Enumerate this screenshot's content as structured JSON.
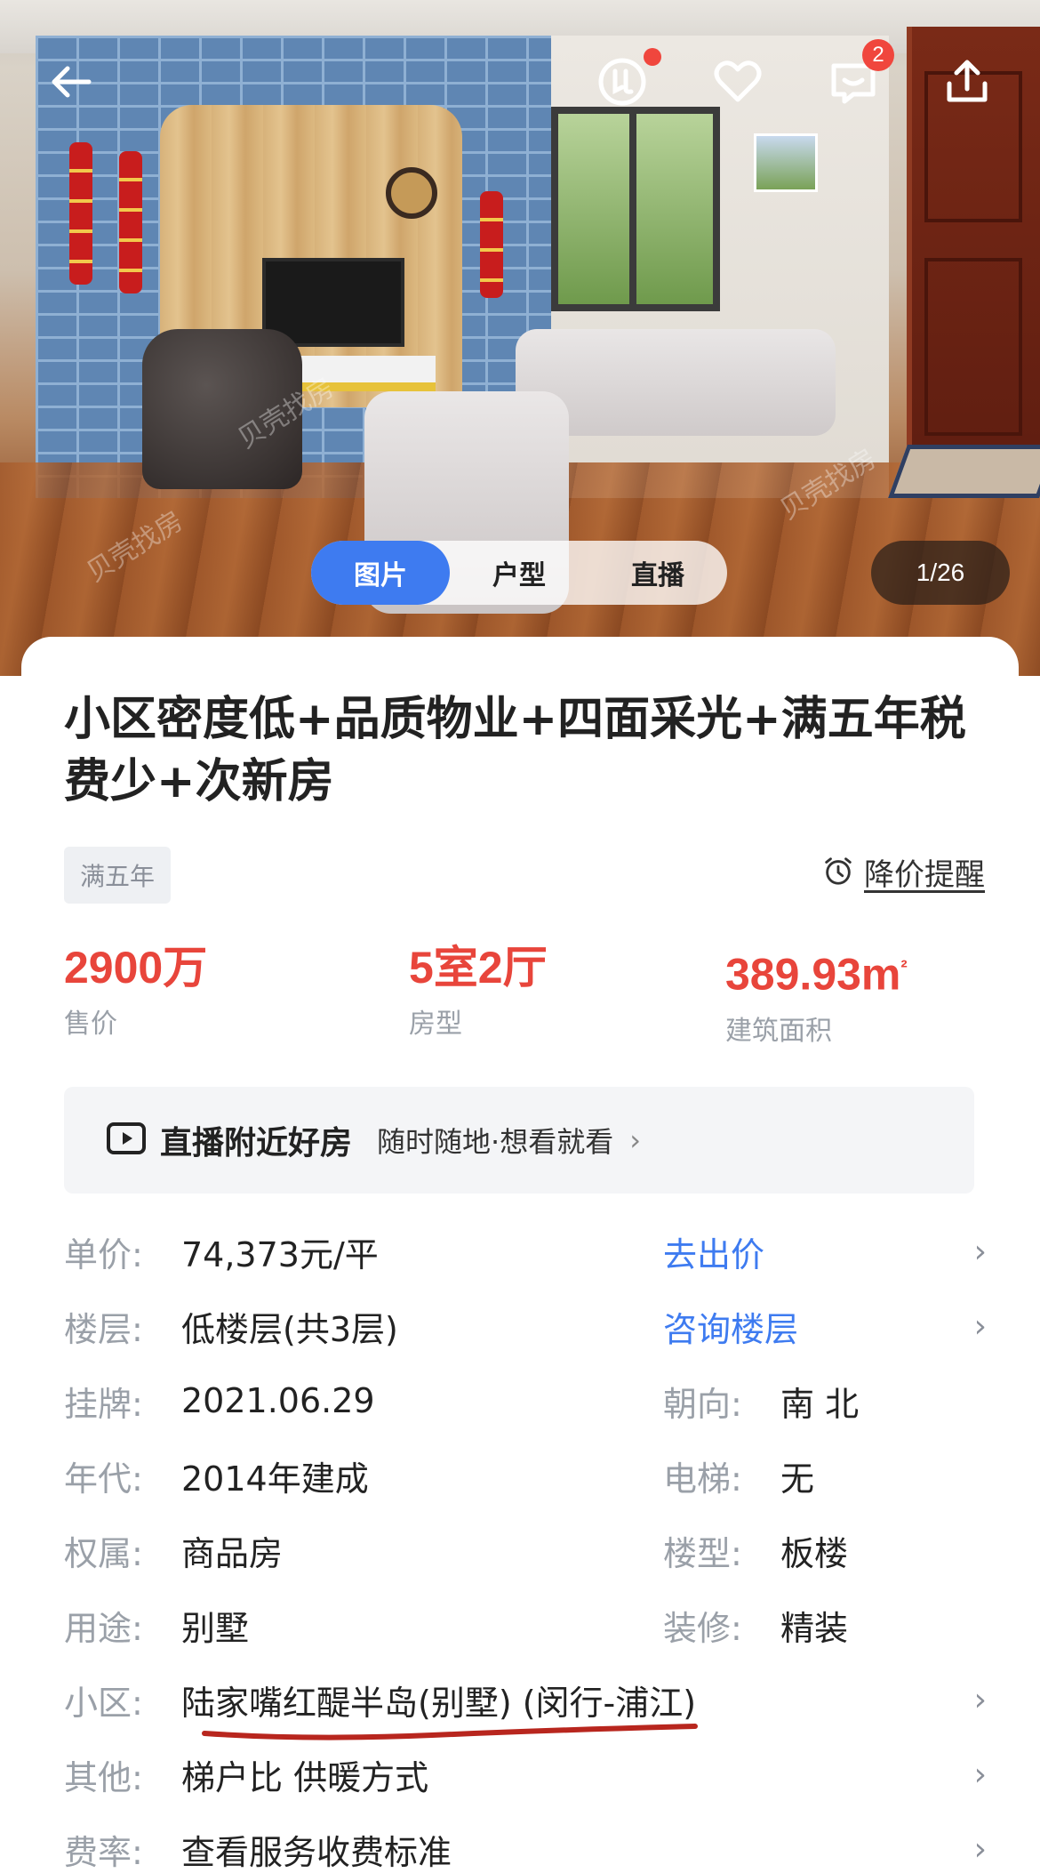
{
  "nav": {
    "back_icon": "back-arrow-icon",
    "compare_icon": "compare-icon",
    "favorite_icon": "heart-icon",
    "message_icon": "message-icon",
    "message_badge": "2",
    "share_icon": "share-icon"
  },
  "media": {
    "tabs": [
      "图片",
      "户型",
      "直播"
    ],
    "active_tab": "图片",
    "counter": "1/26"
  },
  "listing": {
    "title": "小区密度低+品质物业+四面采光+满五年税费少+次新房",
    "tag": "满五年",
    "price_alert": "降价提醒",
    "stats": [
      {
        "value": "2900万",
        "label": "售价"
      },
      {
        "value": "5室2厅",
        "label": "房型"
      },
      {
        "value": "389.93m",
        "sup": "²",
        "label": "建筑面积"
      }
    ]
  },
  "live_banner": {
    "title": "直播附近好房",
    "subtitle": "随时随地·想看就看"
  },
  "details": {
    "unit_price": {
      "key": "单价:",
      "value": "74,373元/平",
      "action": "去出价"
    },
    "floor": {
      "key": "楼层:",
      "value": "低楼层(共3层)",
      "action": "咨询楼层"
    },
    "listed": {
      "key": "挂牌:",
      "value": "2021.06.29"
    },
    "orientation": {
      "key": "朝向:",
      "value": "南 北"
    },
    "year": {
      "key": "年代:",
      "value": "2014年建成"
    },
    "elevator": {
      "key": "电梯:",
      "value": "无"
    },
    "ownership": {
      "key": "权属:",
      "value": "商品房"
    },
    "building_type": {
      "key": "楼型:",
      "value": "板楼"
    },
    "usage": {
      "key": "用途:",
      "value": "别墅"
    },
    "decoration": {
      "key": "装修:",
      "value": "精装"
    },
    "community": {
      "key": "小区:",
      "value": "陆家嘴红醍半岛(别墅) (闵行-浦江)"
    },
    "other": {
      "key": "其他:",
      "value": "梯户比 供暖方式"
    },
    "fee": {
      "key": "费率:",
      "value": "查看服务收费标准"
    }
  },
  "colors": {
    "accent_blue": "#3e7bf0",
    "price_red": "#e8453b",
    "badge_red": "#f0463d"
  }
}
